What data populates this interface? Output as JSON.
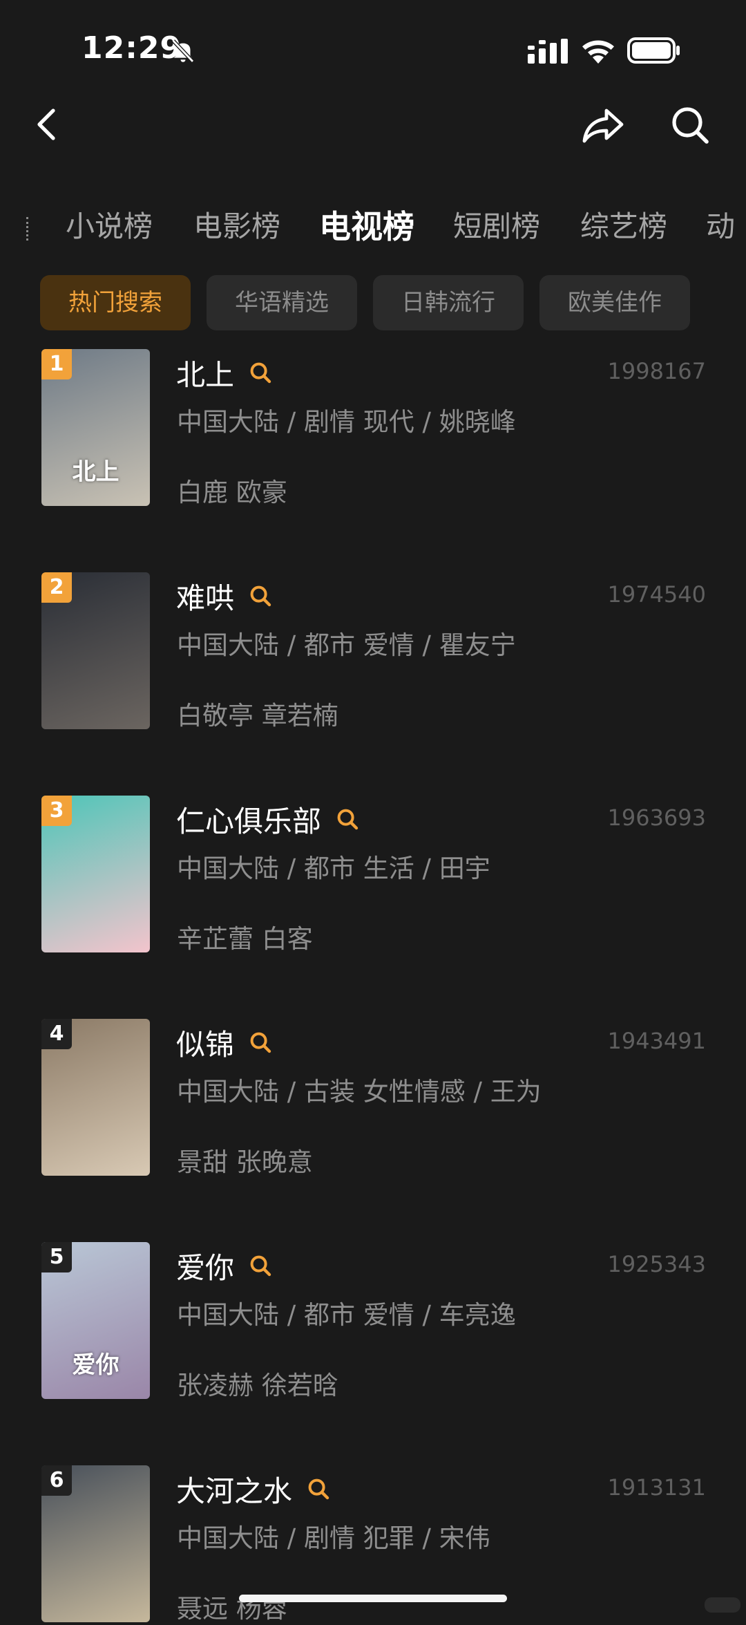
{
  "status_bar": {
    "time": "12:29"
  },
  "category_tabs": [
    {
      "label": "小说榜",
      "active": false
    },
    {
      "label": "电影榜",
      "active": false
    },
    {
      "label": "电视榜",
      "active": true
    },
    {
      "label": "短剧榜",
      "active": false
    },
    {
      "label": "综艺榜",
      "active": false
    },
    {
      "label": "动",
      "active": false
    }
  ],
  "filter_chips": [
    {
      "label": "热门搜索",
      "active": true
    },
    {
      "label": "华语精选",
      "active": false
    },
    {
      "label": "日韩流行",
      "active": false
    },
    {
      "label": "欧美佳作",
      "active": false
    }
  ],
  "items": [
    {
      "rank": "1",
      "title": "北上",
      "score": "1998167",
      "meta": "中国大陆 / 剧情 现代 / 姚晓峰",
      "cast": "白鹿 欧豪",
      "poster_title": "北上",
      "colors": [
        "#6e7a86",
        "#c9c2b4"
      ]
    },
    {
      "rank": "2",
      "title": "难哄",
      "score": "1974540",
      "meta": "中国大陆 / 都市 爱情 / 瞿友宁",
      "cast": "白敬亭 章若楠",
      "poster_title": "",
      "colors": [
        "#2a2e36",
        "#6b6560"
      ]
    },
    {
      "rank": "3",
      "title": "仁心俱乐部",
      "score": "1963693",
      "meta": "中国大陆 / 都市 生活 / 田宇",
      "cast": "辛芷蕾 白客",
      "poster_title": "",
      "colors": [
        "#4ec5b8",
        "#f3c4cc"
      ]
    },
    {
      "rank": "4",
      "title": "似锦",
      "score": "1943491",
      "meta": "中国大陆 / 古装 女性情感 / 王为",
      "cast": "景甜 张晚意",
      "poster_title": "",
      "colors": [
        "#8b7a66",
        "#d8c9b4"
      ]
    },
    {
      "rank": "5",
      "title": "爱你",
      "score": "1925343",
      "meta": "中国大陆 / 都市 爱情 / 车亮逸",
      "cast": "张凌赫 徐若晗",
      "poster_title": "爱你",
      "colors": [
        "#b9c7d6",
        "#9a86a8"
      ]
    },
    {
      "rank": "6",
      "title": "大河之水",
      "score": "1913131",
      "meta": "中国大陆 / 剧情 犯罪 / 宋伟",
      "cast": "聂远 杨蓉",
      "poster_title": "",
      "colors": [
        "#48505a",
        "#c6b89c"
      ]
    }
  ]
}
